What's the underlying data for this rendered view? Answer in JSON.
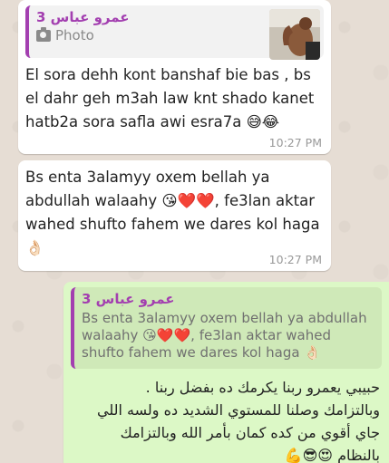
{
  "messages": [
    {
      "direction": "incoming",
      "quote": {
        "author": "3 عمرو عباس",
        "type_label": "Photo"
      },
      "text": "El sora dehh kont banshaf bie bas , bs el dahr geh m3ah law knt shado kanet hatb2a sora safla awi esra7a 😅😂",
      "time": "10:27 PM"
    },
    {
      "direction": "incoming",
      "text": "Bs enta 3alamyy oxem bellah ya abdullah walaahy 😘❤️❤️, fe3lan aktar wahed shufto fahem we dares kol haga 👌🏻",
      "time": "10:27 PM"
    },
    {
      "direction": "outgoing",
      "quote": {
        "author": "3 عمرو عباس",
        "text": "Bs enta 3alamyy oxem bellah ya abdullah walaahy 😘❤️❤️, fe3lan aktar wahed shufto fahem we dares kol haga 👌🏻"
      },
      "text_line1": "حبيبي يعمرو ربنا يكرمك ده بفضل ربنا .",
      "text_line2": "وبالتزامك وصلنا للمستوي الشديد ده ولسه اللي جاي أقوي من كده كمان بأمر الله وبالتزامك",
      "text_line3": "بالنظام",
      "text_emojis": "😍😎💪"
    }
  ],
  "colors": {
    "incoming_bg": "#ffffff",
    "outgoing_bg": "#dcf8c6",
    "quote_accent": "#a33fb0",
    "time_text": "#999999"
  }
}
